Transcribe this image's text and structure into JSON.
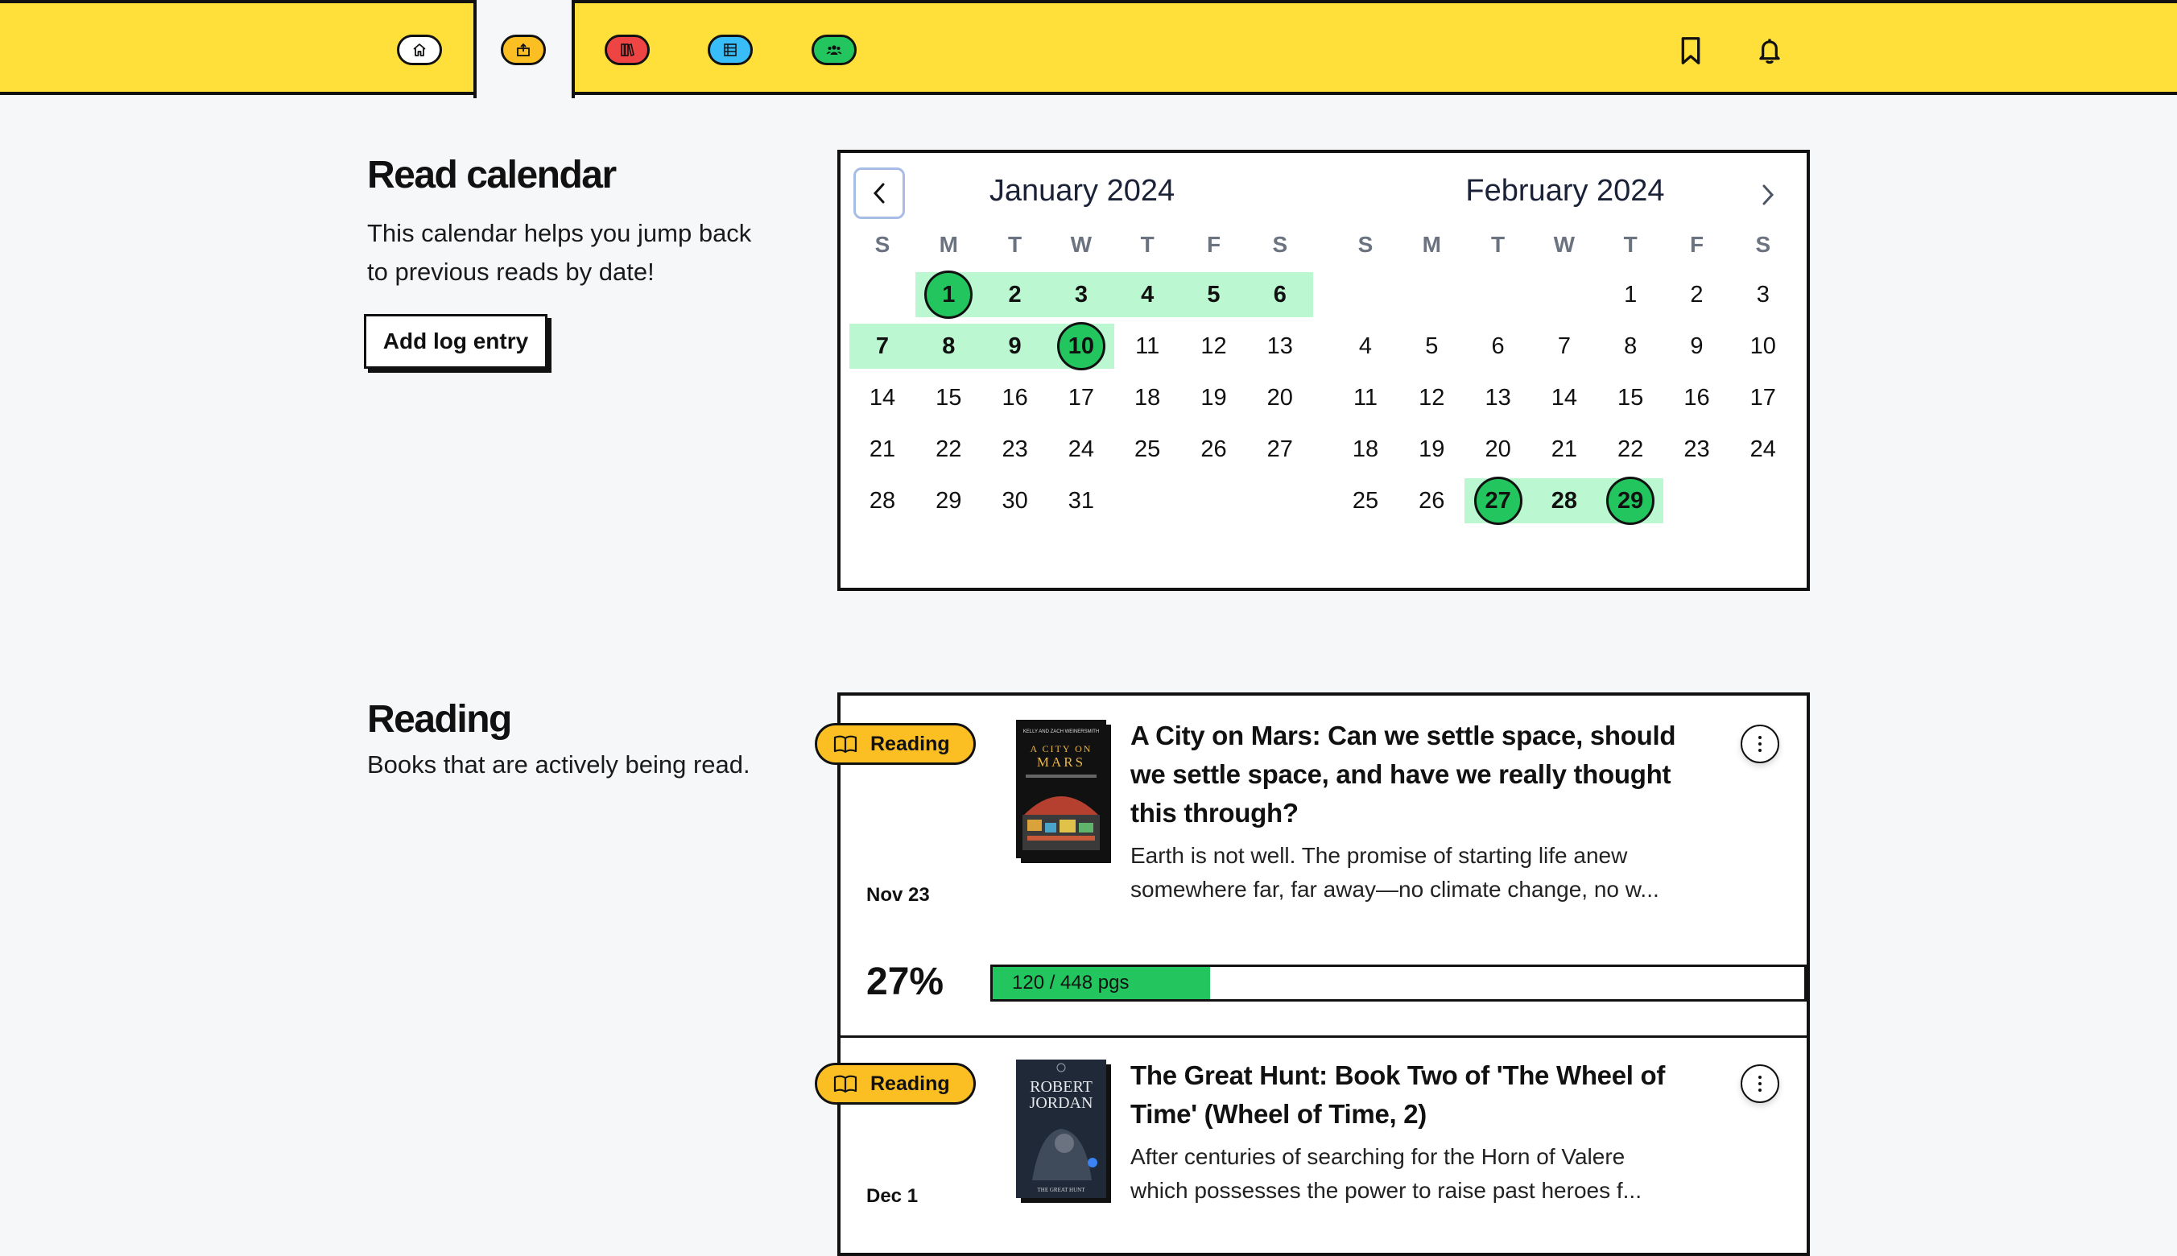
{
  "nav": {
    "items": [
      {
        "name": "home",
        "icon": "home-icon",
        "color": "#ffffff"
      },
      {
        "name": "log",
        "icon": "log-box-icon",
        "color": "#fbbf24",
        "active": true
      },
      {
        "name": "library",
        "icon": "books-icon",
        "color": "#ef4444"
      },
      {
        "name": "lists",
        "icon": "list-icon",
        "color": "#38bdf8"
      },
      {
        "name": "friends",
        "icon": "people-icon",
        "color": "#22c55e"
      }
    ],
    "right_icons": [
      "bookmark-icon",
      "bell-icon"
    ]
  },
  "calendar_section": {
    "title": "Read calendar",
    "description_line1": "This calendar helps you jump back",
    "description_line2": "to previous reads by date!",
    "add_button": "Add log entry"
  },
  "calendar": {
    "weekday_labels": [
      "S",
      "M",
      "T",
      "W",
      "T",
      "F",
      "S"
    ],
    "months": [
      {
        "title": "January 2024",
        "first_weekday": 1,
        "days_in_month": 31,
        "read_days": [
          1,
          2,
          3,
          4,
          5,
          6,
          7,
          8,
          9,
          10
        ],
        "circled_days": [
          1,
          10
        ]
      },
      {
        "title": "February 2024",
        "first_weekday": 4,
        "days_in_month": 29,
        "read_days": [
          27,
          28,
          29
        ],
        "circled_days": [
          27,
          29
        ]
      }
    ]
  },
  "reading_section": {
    "title": "Reading",
    "description": "Books that are actively being read."
  },
  "books": [
    {
      "status": "Reading",
      "title_line1": "A City on Mars: Can we settle space, should",
      "title_line2": "we settle space, and have we really thought",
      "title_line3": "this through?",
      "desc_line1": "Earth is not well. The promise of starting life anew",
      "desc_line2": "somewhere far, far away—no climate change, no w...",
      "date": "Nov 23",
      "percent": "27%",
      "pages_read": 120,
      "pages_total": 448,
      "progress_label": "120 / 448 pgs",
      "cover": {
        "top_text": "KELLY AND ZACH WEINERSMITH",
        "title1": "A CITY ON",
        "title2": "MARS",
        "bg": "#111111"
      }
    },
    {
      "status": "Reading",
      "title_line1": "The Great Hunt: Book Two of 'The Wheel of",
      "title_line2": "Time' (Wheel of Time, 2)",
      "desc_line1": "After centuries of searching for the Horn of Valere",
      "desc_line2": "which possesses the power to raise past heroes f...",
      "date": "Dec 1",
      "cover": {
        "author1": "ROBERT",
        "author2": "JORDAN",
        "subtitle": "THE GREAT HUNT",
        "bg": "#1f2937"
      }
    }
  ],
  "colors": {
    "topbar": "#ffe03b",
    "read_highlight": "#bbf7d0",
    "read_circle": "#22c55e",
    "badge": "#fbbf24",
    "progress": "#22c55e"
  }
}
